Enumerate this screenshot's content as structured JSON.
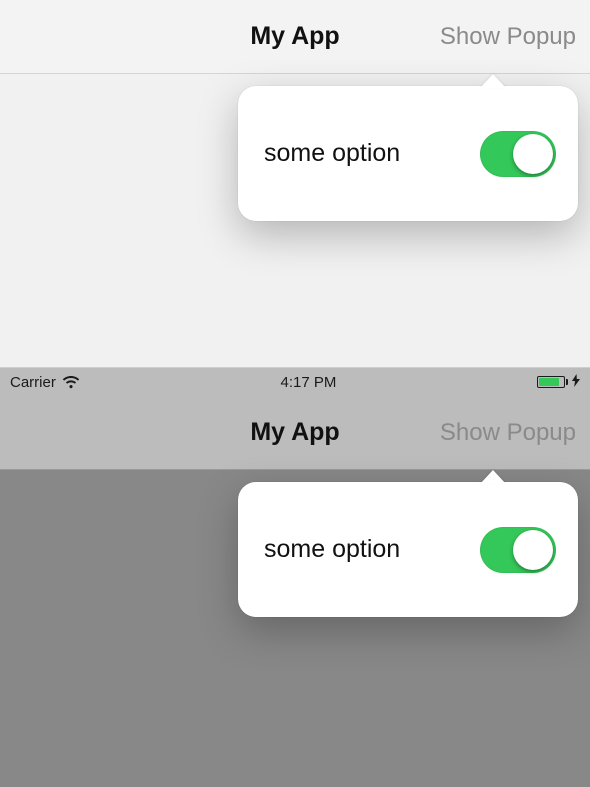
{
  "top": {
    "nav": {
      "title": "My App",
      "right_button": "Show Popup"
    },
    "popover": {
      "option_label": "some option",
      "switch_on": true
    }
  },
  "bottom": {
    "statusbar": {
      "carrier": "Carrier",
      "time": "4:17 PM"
    },
    "nav": {
      "title": "My App",
      "right_button": "Show Popup"
    },
    "popover": {
      "option_label": "some option",
      "switch_on": true
    }
  },
  "colors": {
    "switch_on": "#34c759",
    "nav_title": "#111111",
    "nav_button_disabled": "#8a8a8a"
  }
}
